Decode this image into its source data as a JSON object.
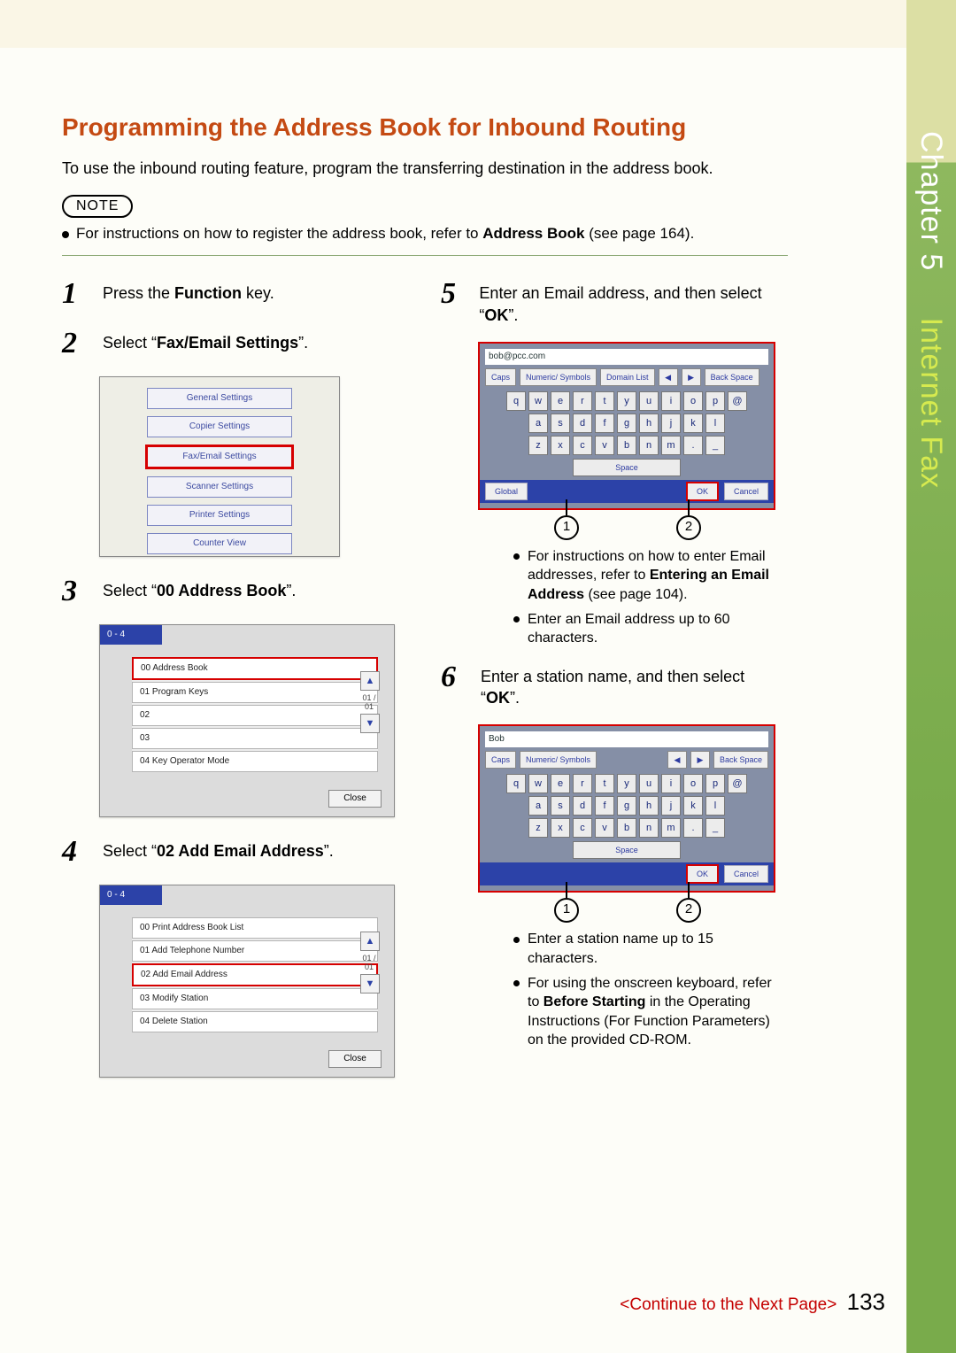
{
  "sidebar": {
    "chapter": "Chapter 5",
    "title": "Internet Fax"
  },
  "heading": "Programming the Address Book for Inbound Routing",
  "intro": "To use the inbound routing feature, program the transferring destination in the address book.",
  "note": {
    "label": "NOTE",
    "text_pre": "For instructions on how to register the address book, refer to ",
    "bold": "Address Book",
    "text_post": " (see page 164)."
  },
  "steps": {
    "s1": {
      "num": "1",
      "text_pre": "Press the ",
      "bold": "Function",
      "text_post": " key."
    },
    "s2": {
      "num": "2",
      "text_pre": "Select “",
      "bold": "Fax/Email Settings",
      "text_post": "”."
    },
    "s3": {
      "num": "3",
      "text_pre": "Select “",
      "bold": "00 Address Book",
      "text_post": "”."
    },
    "s4": {
      "num": "4",
      "text_pre": "Select “",
      "bold": "02 Add Email Address",
      "text_post": "”."
    },
    "s5": {
      "num": "5",
      "text_pre": "Enter an Email address, and then select “",
      "bold": "OK",
      "text_post": "”."
    },
    "s6": {
      "num": "6",
      "text_pre": "Enter a station name, and then select “",
      "bold": "OK",
      "text_post": "”."
    }
  },
  "shot_settings": {
    "items": [
      "General Settings",
      "Copier Settings",
      "Fax/Email Settings",
      "Scanner Settings",
      "Printer Settings",
      "Counter View"
    ]
  },
  "shot_menu": {
    "header": "0  -  4",
    "rows": [
      "00   Address Book",
      "01   Program Keys",
      "02",
      "03",
      "04   Key Operator Mode"
    ],
    "page": "01\n/\n01",
    "close": "Close"
  },
  "shot_email_menu": {
    "header": "0  -  4",
    "rows": [
      "00   Print Address Book List",
      "01   Add Telephone Number",
      "02   Add Email Address",
      "03   Modify Station",
      "04   Delete Station"
    ],
    "page": "01\n/\n01",
    "close": "Close"
  },
  "kb": {
    "row1": [
      "q",
      "w",
      "e",
      "r",
      "t",
      "y",
      "u",
      "i",
      "o",
      "p",
      "@"
    ],
    "row2": [
      "a",
      "s",
      "d",
      "f",
      "g",
      "h",
      "j",
      "k",
      "l"
    ],
    "row3": [
      "z",
      "x",
      "c",
      "v",
      "b",
      "n",
      "m",
      ".",
      "_"
    ],
    "space": "Space",
    "caps": "Caps",
    "numsym": "Numeric/\nSymbols",
    "domain": "Domain List",
    "back": "Back Space",
    "global": "Global",
    "ok": "OK",
    "cancel": "Cancel",
    "input_email": "bob@pcc.com",
    "input_name": "Bob"
  },
  "callouts": {
    "c1": "1",
    "c2": "2"
  },
  "bullets_step5": [
    {
      "pre": "For instructions on how to enter Email addresses, refer to ",
      "bold": "Entering an Email Address",
      "post": " (see page 104)."
    },
    {
      "pre": "Enter an Email address up to 60 characters.",
      "bold": "",
      "post": ""
    }
  ],
  "bullets_step6": [
    {
      "pre": "Enter a station name up to 15 characters.",
      "bold": "",
      "post": ""
    },
    {
      "pre": "For using the onscreen keyboard, refer to ",
      "bold": "Before Starting",
      "post": " in the Operating Instructions (For Function Parameters) on the provided CD-ROM."
    }
  ],
  "footer": {
    "cont": "<Continue to the Next Page>",
    "page": "133"
  }
}
